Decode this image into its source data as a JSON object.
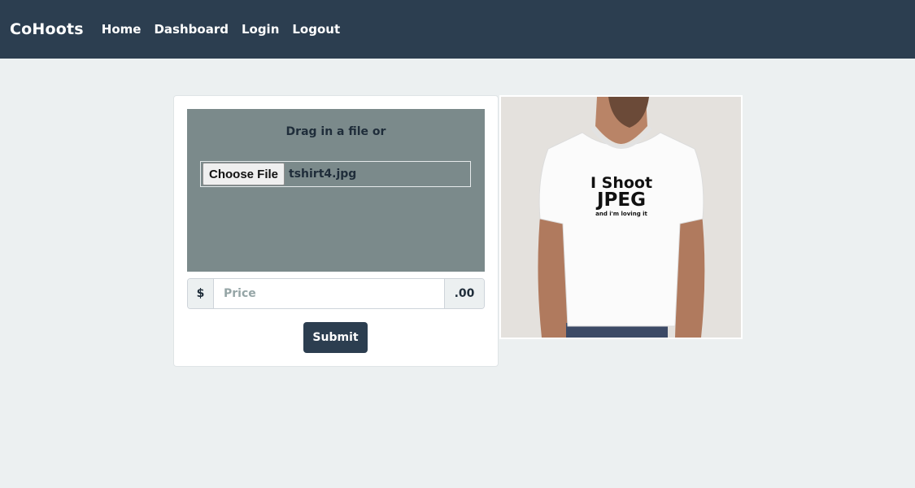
{
  "navbar": {
    "brand": "CoHoots",
    "links": [
      "Home",
      "Dashboard",
      "Login",
      "Logout"
    ]
  },
  "upload": {
    "drag_text": "Drag in a file or",
    "choose_file_label": "Choose File",
    "file_name": "tshirt4.jpg"
  },
  "price": {
    "prefix": "$",
    "placeholder": "Price",
    "suffix": ".00"
  },
  "submit_label": "Submit",
  "preview": {
    "shirt_line1": "I Shoot",
    "shirt_line2": "JPEG",
    "shirt_line3": "and i'm loving it"
  },
  "colors": {
    "navbar": "#2c3e50",
    "page_background": "#ecf0f1",
    "dropzone": "#7b8a8b",
    "primary": "#2c3e50"
  }
}
